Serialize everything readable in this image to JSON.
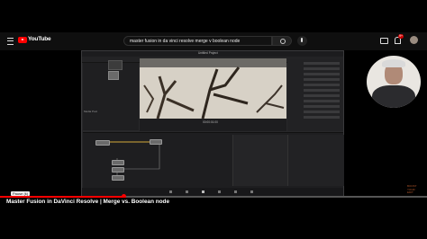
{
  "header": {
    "logo_text": "YouTube",
    "search": {
      "value": "master fusion in da vinci resolve merge v boolean node"
    },
    "notifications_badge": "9+"
  },
  "resolve": {
    "window_title": "Untitled Project",
    "viewer_timecode": "00:00:01:00",
    "media_pool_label": "Media Pool"
  },
  "player": {
    "progress_fraction": 0.29,
    "pause_label": "Pause (k)"
  },
  "video": {
    "title": "Master Fusion in DaVinci Resolve | Merge vs. Boolean node",
    "corner_logo": "BOOST YOUR EDIT"
  },
  "colors": {
    "accent": "#ff0000",
    "background": "#000000"
  }
}
